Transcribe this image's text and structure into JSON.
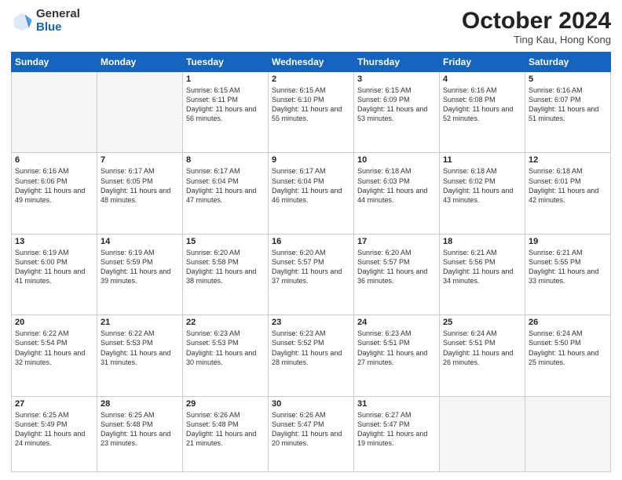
{
  "header": {
    "logo_general": "General",
    "logo_blue": "Blue",
    "month": "October 2024",
    "location": "Ting Kau, Hong Kong"
  },
  "days_of_week": [
    "Sunday",
    "Monday",
    "Tuesday",
    "Wednesday",
    "Thursday",
    "Friday",
    "Saturday"
  ],
  "weeks": [
    [
      {
        "day": "",
        "info": ""
      },
      {
        "day": "",
        "info": ""
      },
      {
        "day": "1",
        "info": "Sunrise: 6:15 AM\nSunset: 6:11 PM\nDaylight: 11 hours and 56 minutes."
      },
      {
        "day": "2",
        "info": "Sunrise: 6:15 AM\nSunset: 6:10 PM\nDaylight: 11 hours and 55 minutes."
      },
      {
        "day": "3",
        "info": "Sunrise: 6:15 AM\nSunset: 6:09 PM\nDaylight: 11 hours and 53 minutes."
      },
      {
        "day": "4",
        "info": "Sunrise: 6:16 AM\nSunset: 6:08 PM\nDaylight: 11 hours and 52 minutes."
      },
      {
        "day": "5",
        "info": "Sunrise: 6:16 AM\nSunset: 6:07 PM\nDaylight: 11 hours and 51 minutes."
      }
    ],
    [
      {
        "day": "6",
        "info": "Sunrise: 6:16 AM\nSunset: 6:06 PM\nDaylight: 11 hours and 49 minutes."
      },
      {
        "day": "7",
        "info": "Sunrise: 6:17 AM\nSunset: 6:05 PM\nDaylight: 11 hours and 48 minutes."
      },
      {
        "day": "8",
        "info": "Sunrise: 6:17 AM\nSunset: 6:04 PM\nDaylight: 11 hours and 47 minutes."
      },
      {
        "day": "9",
        "info": "Sunrise: 6:17 AM\nSunset: 6:04 PM\nDaylight: 11 hours and 46 minutes."
      },
      {
        "day": "10",
        "info": "Sunrise: 6:18 AM\nSunset: 6:03 PM\nDaylight: 11 hours and 44 minutes."
      },
      {
        "day": "11",
        "info": "Sunrise: 6:18 AM\nSunset: 6:02 PM\nDaylight: 11 hours and 43 minutes."
      },
      {
        "day": "12",
        "info": "Sunrise: 6:18 AM\nSunset: 6:01 PM\nDaylight: 11 hours and 42 minutes."
      }
    ],
    [
      {
        "day": "13",
        "info": "Sunrise: 6:19 AM\nSunset: 6:00 PM\nDaylight: 11 hours and 41 minutes."
      },
      {
        "day": "14",
        "info": "Sunrise: 6:19 AM\nSunset: 5:59 PM\nDaylight: 11 hours and 39 minutes."
      },
      {
        "day": "15",
        "info": "Sunrise: 6:20 AM\nSunset: 5:58 PM\nDaylight: 11 hours and 38 minutes."
      },
      {
        "day": "16",
        "info": "Sunrise: 6:20 AM\nSunset: 5:57 PM\nDaylight: 11 hours and 37 minutes."
      },
      {
        "day": "17",
        "info": "Sunrise: 6:20 AM\nSunset: 5:57 PM\nDaylight: 11 hours and 36 minutes."
      },
      {
        "day": "18",
        "info": "Sunrise: 6:21 AM\nSunset: 5:56 PM\nDaylight: 11 hours and 34 minutes."
      },
      {
        "day": "19",
        "info": "Sunrise: 6:21 AM\nSunset: 5:55 PM\nDaylight: 11 hours and 33 minutes."
      }
    ],
    [
      {
        "day": "20",
        "info": "Sunrise: 6:22 AM\nSunset: 5:54 PM\nDaylight: 11 hours and 32 minutes."
      },
      {
        "day": "21",
        "info": "Sunrise: 6:22 AM\nSunset: 5:53 PM\nDaylight: 11 hours and 31 minutes."
      },
      {
        "day": "22",
        "info": "Sunrise: 6:23 AM\nSunset: 5:53 PM\nDaylight: 11 hours and 30 minutes."
      },
      {
        "day": "23",
        "info": "Sunrise: 6:23 AM\nSunset: 5:52 PM\nDaylight: 11 hours and 28 minutes."
      },
      {
        "day": "24",
        "info": "Sunrise: 6:23 AM\nSunset: 5:51 PM\nDaylight: 11 hours and 27 minutes."
      },
      {
        "day": "25",
        "info": "Sunrise: 6:24 AM\nSunset: 5:51 PM\nDaylight: 11 hours and 26 minutes."
      },
      {
        "day": "26",
        "info": "Sunrise: 6:24 AM\nSunset: 5:50 PM\nDaylight: 11 hours and 25 minutes."
      }
    ],
    [
      {
        "day": "27",
        "info": "Sunrise: 6:25 AM\nSunset: 5:49 PM\nDaylight: 11 hours and 24 minutes."
      },
      {
        "day": "28",
        "info": "Sunrise: 6:25 AM\nSunset: 5:48 PM\nDaylight: 11 hours and 23 minutes."
      },
      {
        "day": "29",
        "info": "Sunrise: 6:26 AM\nSunset: 5:48 PM\nDaylight: 11 hours and 21 minutes."
      },
      {
        "day": "30",
        "info": "Sunrise: 6:26 AM\nSunset: 5:47 PM\nDaylight: 11 hours and 20 minutes."
      },
      {
        "day": "31",
        "info": "Sunrise: 6:27 AM\nSunset: 5:47 PM\nDaylight: 11 hours and 19 minutes."
      },
      {
        "day": "",
        "info": ""
      },
      {
        "day": "",
        "info": ""
      }
    ]
  ]
}
